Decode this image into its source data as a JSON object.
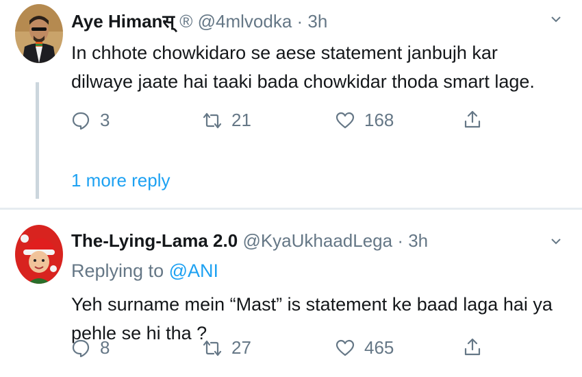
{
  "tweets": [
    {
      "author_name": "Aye Himanस्",
      "verified_symbol": " ®",
      "handle_time": "@4mlvodka · 3h",
      "text": "In chhote chowkidaro se aese statement janbujh kar dilwaye jaate hai taaki bada chowkidar thoda smart lage.",
      "replies": "3",
      "retweets": "21",
      "likes": "168",
      "more_replies": "1 more reply"
    },
    {
      "author_name": "The-Lying-Lama 2.0",
      "handle_time": "@KyaUkhaadLega · 3h",
      "replying_label": "Replying to",
      "replying_to": "@ANI",
      "text": "Yeh surname mein “Mast” is statement ke baad laga hai ya pehle se hi tha ?",
      "replies": "8",
      "retweets": "27",
      "likes": "465"
    }
  ],
  "icons": {
    "reply": "reply-icon",
    "retweet": "retweet-icon",
    "like": "heart-icon",
    "share": "share-icon",
    "menu": "chevron-down-icon"
  },
  "colors": {
    "link": "#1da1f2",
    "secondary_text": "#657786",
    "divider": "#e6ecf0"
  }
}
